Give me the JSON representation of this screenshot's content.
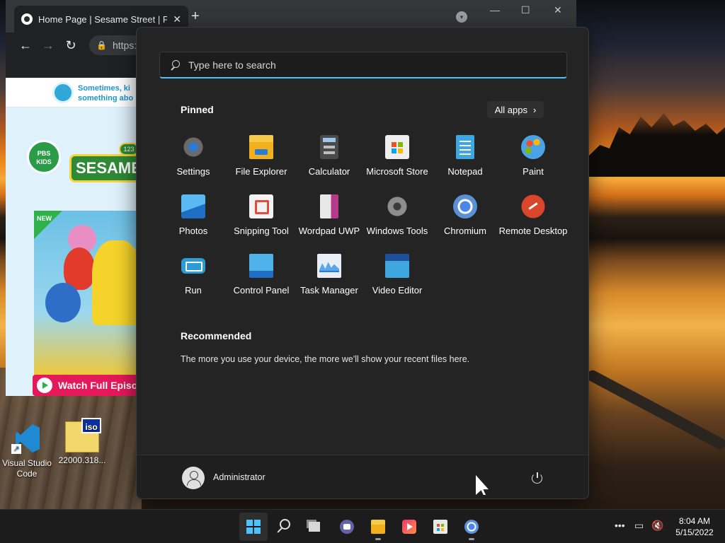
{
  "browser": {
    "tab_title": "Home Page | Sesame Street | PB",
    "tab_close": "✕",
    "new_tab": "+",
    "url": "https:/",
    "window_min": "—",
    "window_max": "☐",
    "window_close": "✕",
    "back": "←",
    "forward": "→",
    "reload": "↻",
    "lock": "🔒",
    "page": {
      "banner_text": "Sometimes, ki\nsomething abo",
      "pbs_logo": "PBS KIDS",
      "sesame_logo": "SESAME S",
      "sesame_badge": "123",
      "new_badge": "NEW",
      "watch_button": "Watch Full Episo"
    }
  },
  "desktop": {
    "icons": [
      {
        "label": "Visual Studio Code",
        "icon": "vscode-icon"
      },
      {
        "label": "22000.318...",
        "icon": "iso-file-icon",
        "badge": "iso"
      }
    ]
  },
  "start_menu": {
    "search_placeholder": "Type here to search",
    "pinned_title": "Pinned",
    "all_apps_label": "All apps",
    "all_apps_chevron": "›",
    "pinned_apps": [
      {
        "label": "Settings",
        "icon": "settings-icon"
      },
      {
        "label": "File Explorer",
        "icon": "file-explorer-icon"
      },
      {
        "label": "Calculator",
        "icon": "calculator-icon"
      },
      {
        "label": "Microsoft Store",
        "icon": "microsoft-store-icon"
      },
      {
        "label": "Notepad",
        "icon": "notepad-icon"
      },
      {
        "label": "Paint",
        "icon": "paint-icon"
      },
      {
        "label": "Photos",
        "icon": "photos-icon"
      },
      {
        "label": "Snipping Tool",
        "icon": "snipping-tool-icon"
      },
      {
        "label": "Wordpad UWP",
        "icon": "wordpad-icon"
      },
      {
        "label": "Windows Tools",
        "icon": "windows-tools-icon"
      },
      {
        "label": "Chromium",
        "icon": "chromium-icon"
      },
      {
        "label": "Remote Desktop",
        "icon": "remote-desktop-icon"
      },
      {
        "label": "Run",
        "icon": "run-icon"
      },
      {
        "label": "Control Panel",
        "icon": "control-panel-icon"
      },
      {
        "label": "Task Manager",
        "icon": "task-manager-icon"
      },
      {
        "label": "Video Editor",
        "icon": "video-editor-icon"
      }
    ],
    "recommended_title": "Recommended",
    "recommended_text": "The more you use your device, the more we'll show your recent files here.",
    "user_name": "Administrator"
  },
  "taskbar": {
    "buttons": [
      "start-icon",
      "search-icon",
      "task-view-icon",
      "chat-icon",
      "file-explorer-icon",
      "media-player-icon",
      "microsoft-store-icon",
      "chromium-icon"
    ],
    "tray_overflow": "•••",
    "clock_time": "8:04 AM",
    "clock_date": "5/15/2022"
  },
  "colors": {
    "accent": "#4cc2ff",
    "start_bg": "#242424",
    "taskbar_bg": "#1c1c1c"
  }
}
